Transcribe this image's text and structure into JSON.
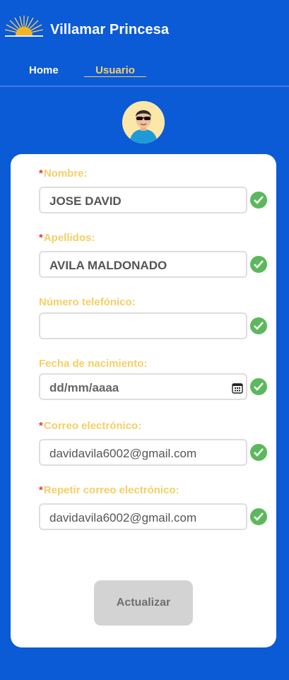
{
  "header": {
    "brand": "Villamar Princesa",
    "nav": {
      "home": "Home",
      "user": "Usuario"
    }
  },
  "form": {
    "nombre": {
      "label": "Nombre:",
      "required": "*",
      "value": "JOSE DAVID"
    },
    "apellidos": {
      "label": "Apellidos:",
      "required": "*",
      "value": "AVILA MALDONADO"
    },
    "telefono": {
      "label": "Número telefónico:",
      "value": ""
    },
    "fecha": {
      "label": "Fecha de nacimiento:",
      "placeholder": "dd/mm/aaaa"
    },
    "correo": {
      "label": "Correo electrónico:",
      "required": "*",
      "value": "davidavila6002@gmail.com"
    },
    "repetir": {
      "label": "Repetir correo electrónico:",
      "required": "*",
      "value": "davidavila6002@gmail.com"
    },
    "submit_label": "Actualizar"
  },
  "icons": {
    "logo": "sunrise-logo",
    "avatar": "user-avatar",
    "valid": "check-circle-icon",
    "calendar": "calendar-icon"
  },
  "colors": {
    "background": "#0b5ad6",
    "label": "#f5cf63",
    "required": "#e23b3b",
    "valid": "#5cb85c",
    "button": "#d3d3d3"
  }
}
